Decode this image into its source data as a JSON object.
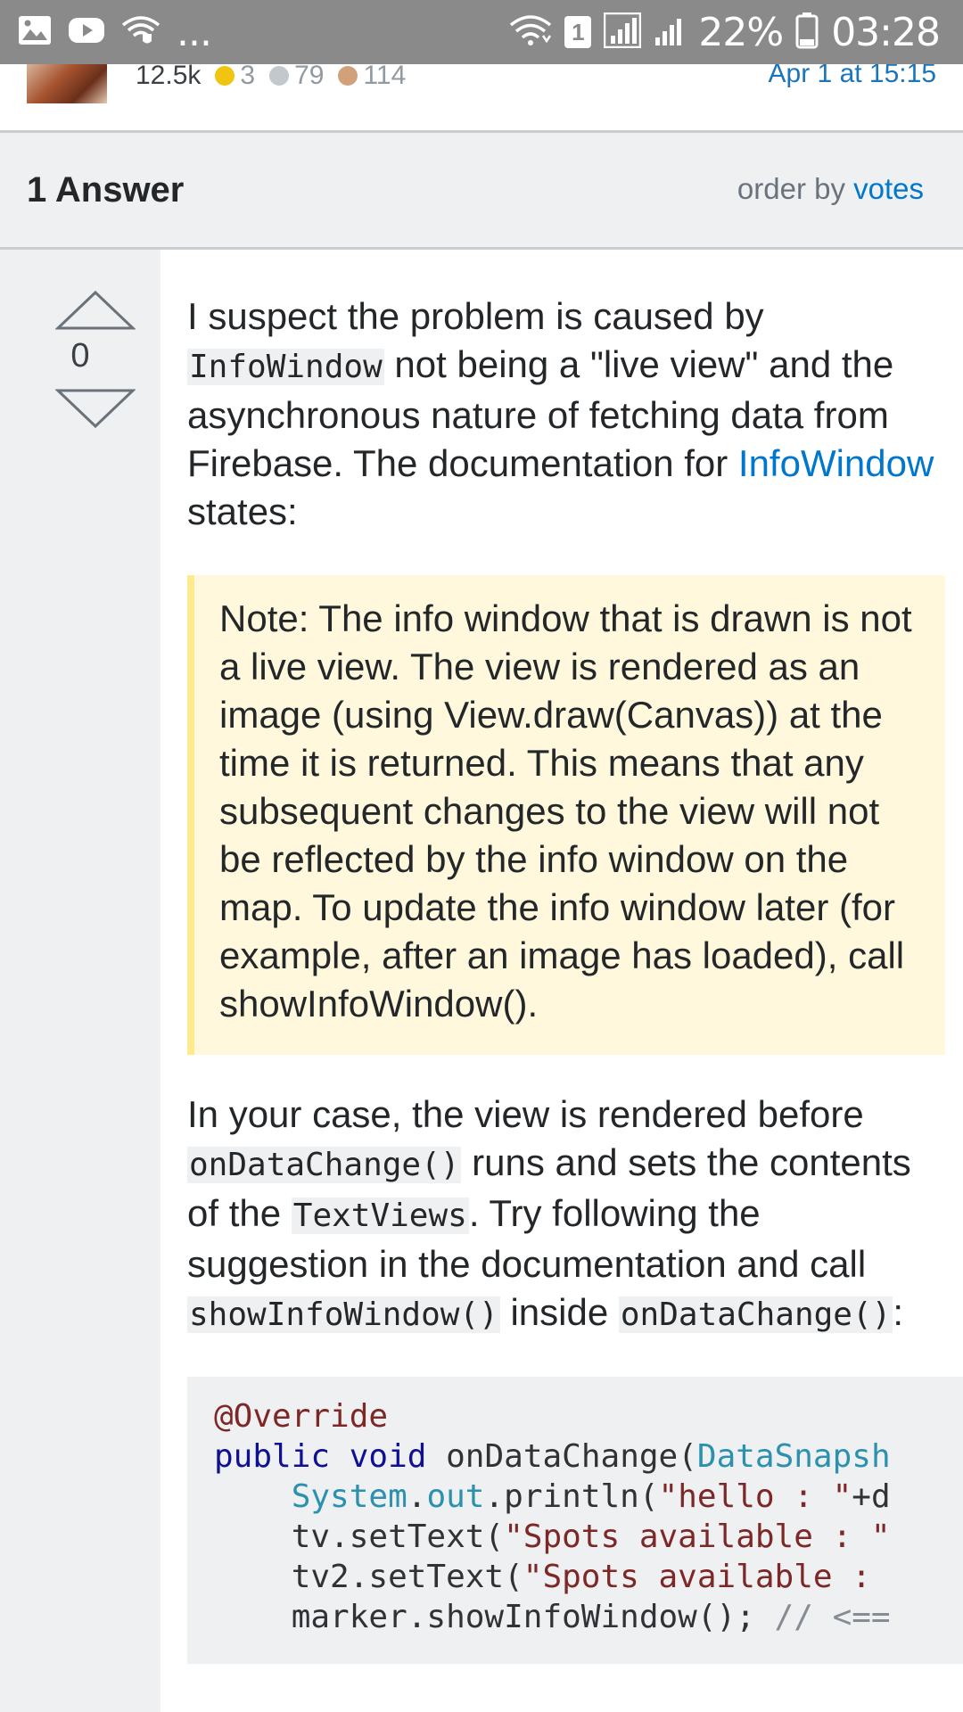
{
  "status_bar": {
    "dots": "...",
    "sim_slot": "1",
    "battery_pct": "22%",
    "time": "03:28"
  },
  "user_card": {
    "reputation": "12.5k",
    "gold": "3",
    "silver": "79",
    "bronze": "114",
    "date": "Apr 1 at 15:15"
  },
  "answers": {
    "title": "1 Answer",
    "order_prefix": "order by",
    "order_value": "votes"
  },
  "answer": {
    "score": "0",
    "p1_a": "I suspect the problem is caused by",
    "p1_code": "InfoWindow",
    "p1_b": "not being a \"live view\" and the asynchronous nature of fetching data from Firebase. The documentation for",
    "p1_link": "InfoWindow",
    "p1_c": "states:",
    "quote": "Note: The info window that is drawn is not a live view. The view is rendered as an image (using View.draw(Canvas)) at the time it is returned. This means that any subsequent changes to the view will not be reflected by the info window on the map. To update the info window later (for example, after an image has loaded), call showInfoWindow().",
    "p2_a": "In your case, the view is rendered before",
    "p2_code1": "onDataChange()",
    "p2_b": "runs and sets the contents of the",
    "p2_code2": "TextViews",
    "p2_c": ". Try following the suggestion in the documentation and call",
    "p2_code3": "showInfoWindow()",
    "p2_d": "inside",
    "p2_code4": "onDataChange()",
    "p2_e": ":",
    "code": {
      "l1": "@Override",
      "l2_k1": "public",
      "l2_k2": "void",
      "l2_fn": "onDataChange(",
      "l2_type": "DataSnapsh",
      "l3_indent": "    ",
      "l3_type": "System",
      "l3_dot": ".",
      "l3_field": "out",
      "l3_call": ".println(",
      "l3_str": "\"hello : \"",
      "l3_rest": "+d",
      "l4_a": "    tv.setText(",
      "l4_str": "\"Spots available : \"",
      "l5_a": "    tv2.setText(",
      "l5_str": "\"Spots available : ",
      "l6_a": "    marker.showInfoWindow(); ",
      "l6_comment": "// <=="
    }
  }
}
